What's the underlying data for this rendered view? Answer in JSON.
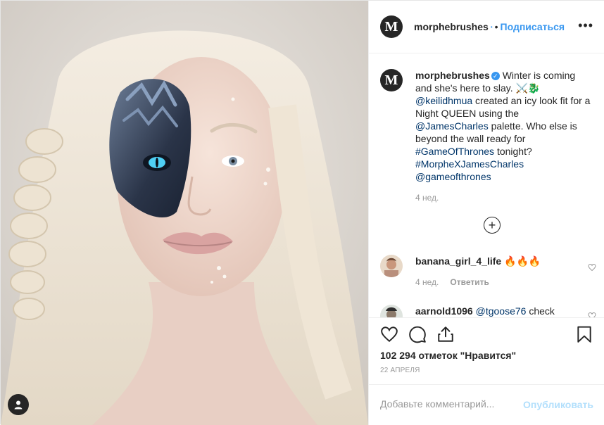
{
  "header": {
    "avatar_letter": "M",
    "username": "morphebrushes",
    "verified_mark": "•",
    "separator": "•",
    "follow_label": "Подписаться",
    "more_label": "•••"
  },
  "caption": {
    "avatar_letter": "M",
    "username": "morphebrushes",
    "verified_icon": "✓",
    "text_1": " Winter is coming and she's here to slay. ⚔️🐉 ",
    "mention_1": "@keilidhmua",
    "text_2": " created an icy look fit for a Night QUEEN using the ",
    "mention_2": "@JamesCharles",
    "text_3": " palette. Who else is beyond the wall ready for ",
    "hashtag_1": "#GameOfThrones",
    "text_4": " tonight? ",
    "hashtag_2": "#MorpheXJamesCharles",
    "text_5": " ",
    "mention_3": "@gameofthrones",
    "time": "4 нед."
  },
  "comments": [
    {
      "username": "banana_girl_4_life",
      "text": " 🔥🔥🔥",
      "time": "4 нед.",
      "reply_label": "Ответить"
    },
    {
      "username": "aarnold1096",
      "mention": "@tgoose76",
      "text": " check"
    }
  ],
  "actions": {
    "like_icon": "heart-icon",
    "comment_icon": "comment-icon",
    "share_icon": "share-icon",
    "save_icon": "bookmark-icon"
  },
  "likes_text": "102 294 отметок \"Нравится\"",
  "date": "22 апреля",
  "add_comment": {
    "placeholder": "Добавьте комментарий...",
    "publish_label": "Опубликовать"
  },
  "colors": {
    "accent": "#3897f0",
    "link": "#003569",
    "muted": "#999999",
    "publish_disabled": "#b2dffc"
  }
}
